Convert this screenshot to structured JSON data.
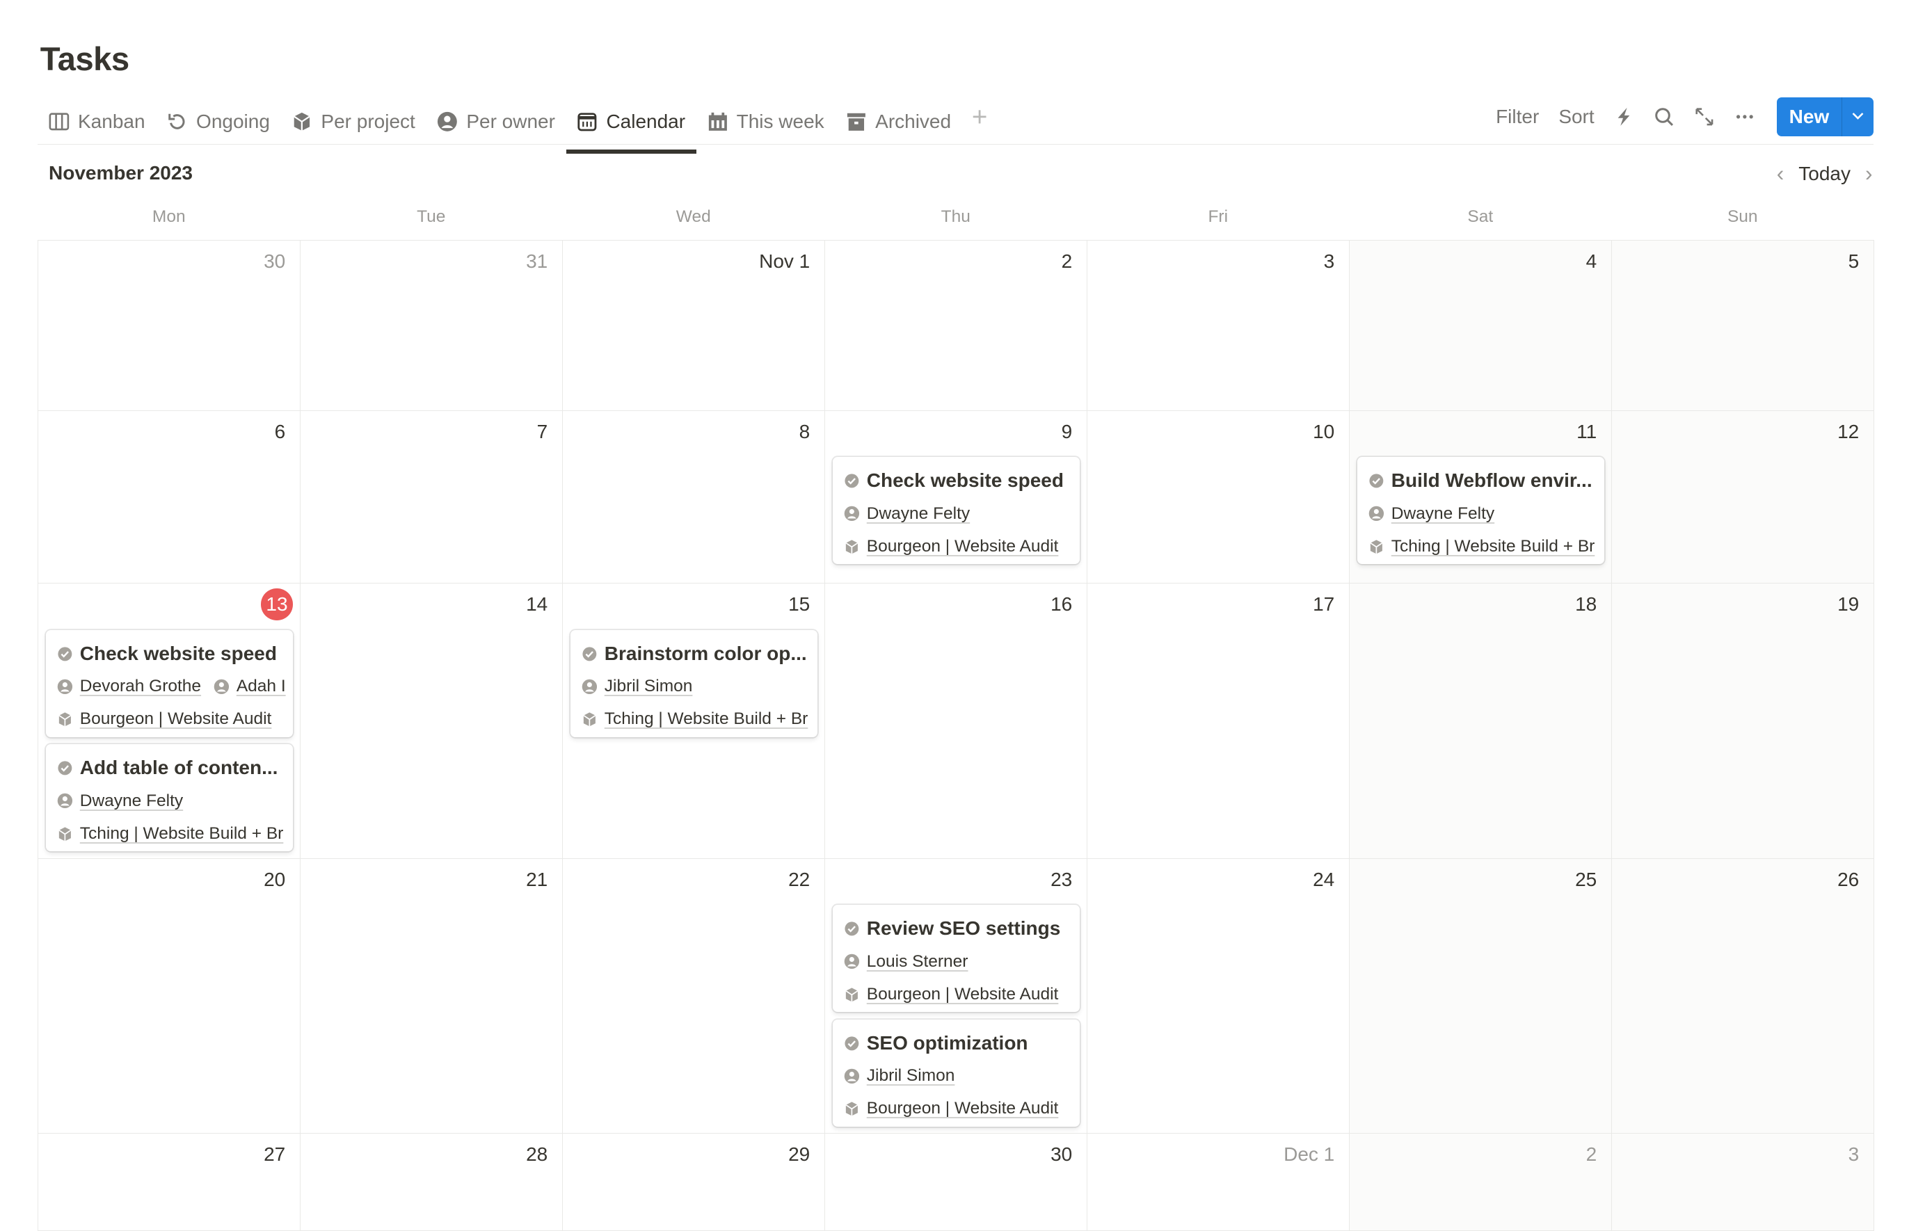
{
  "page_title": "Tasks",
  "tabs": [
    {
      "label": "Kanban",
      "icon": "columns-icon"
    },
    {
      "label": "Ongoing",
      "icon": "refresh-icon"
    },
    {
      "label": "Per project",
      "icon": "cube-icon"
    },
    {
      "label": "Per owner",
      "icon": "person-icon"
    },
    {
      "label": "Calendar",
      "icon": "calendar-icon",
      "active": true
    },
    {
      "label": "This week",
      "icon": "week-icon"
    },
    {
      "label": "Archived",
      "icon": "archive-icon"
    }
  ],
  "toolbar": {
    "filter": "Filter",
    "sort": "Sort",
    "new": "New"
  },
  "calendar": {
    "month_label": "November 2023",
    "today_label": "Today",
    "weekdays": [
      "Mon",
      "Tue",
      "Wed",
      "Thu",
      "Fri",
      "Sat",
      "Sun"
    ],
    "weeks": [
      {
        "days": [
          {
            "label": "30",
            "muted": true
          },
          {
            "label": "31",
            "muted": true
          },
          {
            "label": "Nov 1"
          },
          {
            "label": "2"
          },
          {
            "label": "3"
          },
          {
            "label": "4"
          },
          {
            "label": "5"
          }
        ]
      },
      {
        "days": [
          {
            "label": "6"
          },
          {
            "label": "7"
          },
          {
            "label": "8"
          },
          {
            "label": "9",
            "cards": [
              {
                "title": "Check website speed",
                "owners": [
                  "Dwayne Felty"
                ],
                "project": "Bourgeon | Website Audit"
              }
            ]
          },
          {
            "label": "10"
          },
          {
            "label": "11",
            "cards": [
              {
                "title": "Build Webflow envir...",
                "owners": [
                  "Dwayne Felty"
                ],
                "project": "Tching | Website Build + Br"
              }
            ]
          },
          {
            "label": "12"
          }
        ]
      },
      {
        "days": [
          {
            "label": "13",
            "today": true,
            "cards": [
              {
                "title": "Check website speed",
                "owners": [
                  "Devorah Grothe",
                  "Adah I"
                ],
                "project": "Bourgeon | Website Audit"
              },
              {
                "title": "Add table of conten...",
                "owners": [
                  "Dwayne Felty"
                ],
                "project": "Tching | Website Build + Br"
              }
            ]
          },
          {
            "label": "14"
          },
          {
            "label": "15",
            "cards": [
              {
                "title": "Brainstorm color op...",
                "owners": [
                  "Jibril Simon"
                ],
                "project": "Tching | Website Build + Br"
              }
            ]
          },
          {
            "label": "16"
          },
          {
            "label": "17"
          },
          {
            "label": "18"
          },
          {
            "label": "19"
          }
        ]
      },
      {
        "days": [
          {
            "label": "20"
          },
          {
            "label": "21"
          },
          {
            "label": "22"
          },
          {
            "label": "23",
            "cards": [
              {
                "title": "Review SEO settings",
                "owners": [
                  "Louis Sterner"
                ],
                "project": "Bourgeon | Website Audit"
              },
              {
                "title": "SEO optimization",
                "owners": [
                  "Jibril Simon"
                ],
                "project": "Bourgeon | Website Audit"
              }
            ]
          },
          {
            "label": "24"
          },
          {
            "label": "25"
          },
          {
            "label": "26"
          }
        ]
      },
      {
        "days": [
          {
            "label": "27"
          },
          {
            "label": "28"
          },
          {
            "label": "29"
          },
          {
            "label": "30"
          },
          {
            "label": "Dec 1",
            "muted": true
          },
          {
            "label": "2",
            "muted": true
          },
          {
            "label": "3",
            "muted": true
          }
        ]
      }
    ]
  },
  "colors": {
    "accent": "#2383e2",
    "today": "#eb5757",
    "text": "#37352f",
    "muted": "#787774"
  }
}
